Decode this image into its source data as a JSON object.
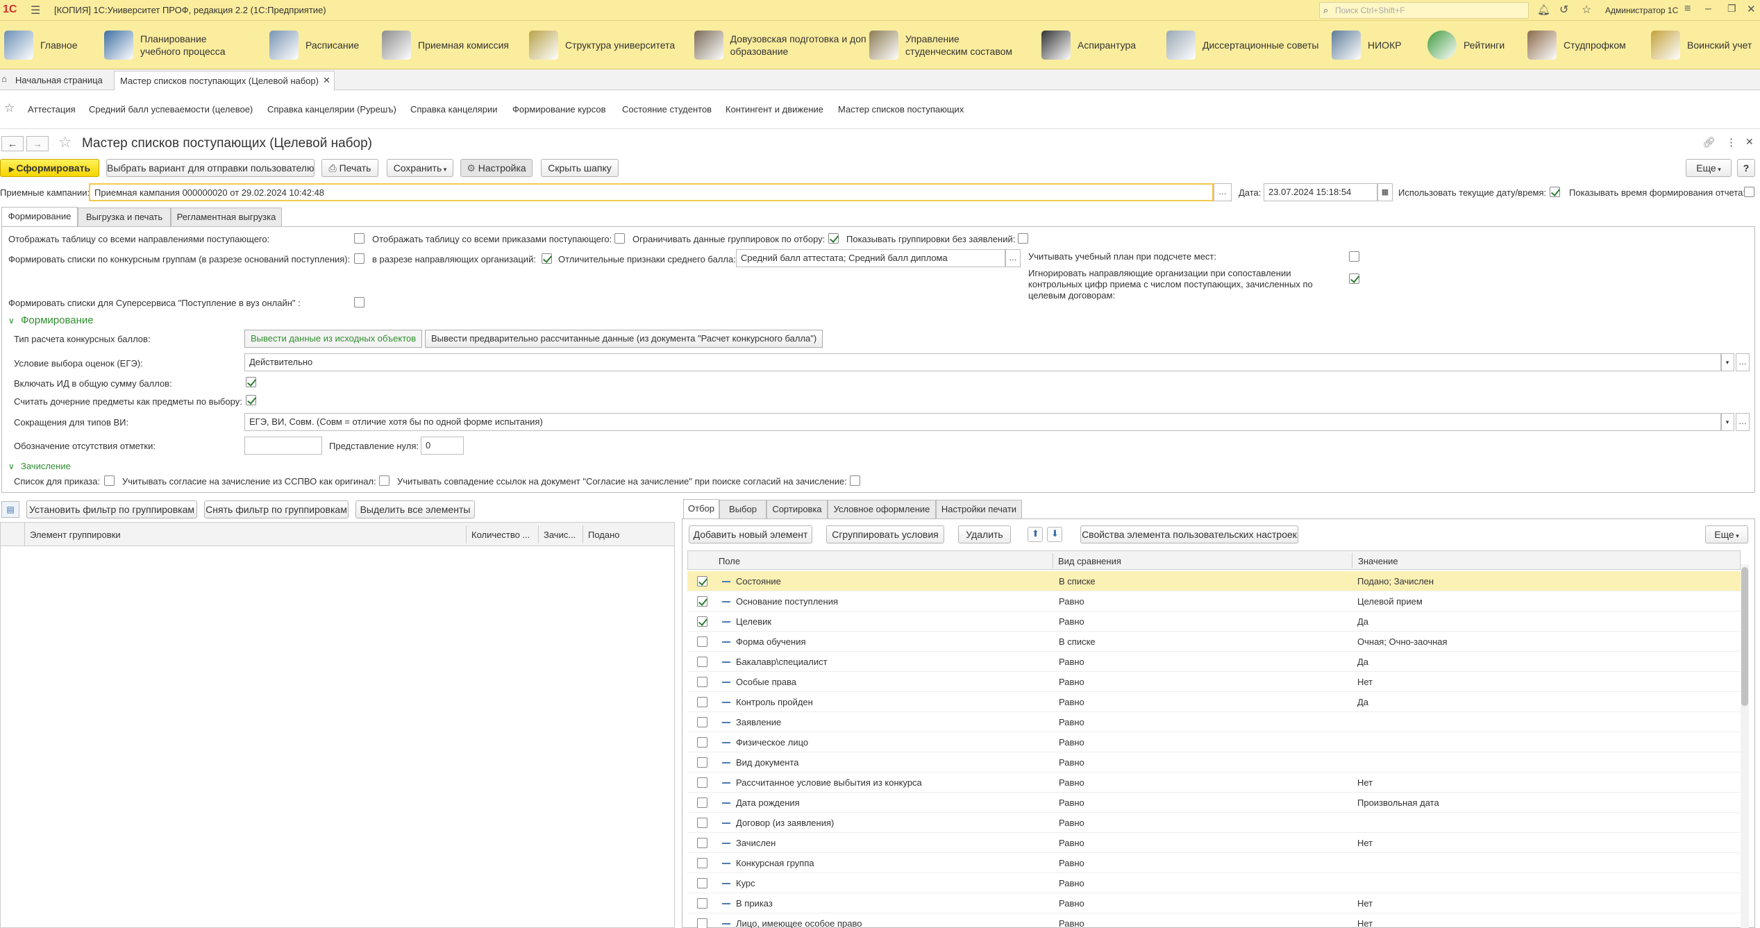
{
  "titlebar": {
    "logo": "1С",
    "title": "[КОПИЯ] 1С:Университет ПРОФ, редакция 2.2  (1С:Предприятие)",
    "search_placeholder": "Поиск Ctrl+Shift+F",
    "user": "Администратор 1С"
  },
  "sections": [
    {
      "label": "Главное",
      "color": "#6b8fb5"
    },
    {
      "label": "Планирование учебного процесса",
      "color": "#3f6fa3"
    },
    {
      "label": "Расписание",
      "color": "#7a95b3"
    },
    {
      "label": "Приемная комиссия",
      "color": "#8d8d8d"
    },
    {
      "label": "Структура университета",
      "color": "#b7a34a"
    },
    {
      "label": "Довузовская подготовка и доп образование",
      "color": "#7a6b58"
    },
    {
      "label": "Управление студенческим составом",
      "color": "#8c7d56"
    },
    {
      "label": "Аспирантура",
      "color": "#333333"
    },
    {
      "label": "Диссертационные советы",
      "color": "#9aa8b6"
    },
    {
      "label": "НИОКР",
      "color": "#5f7c9a"
    },
    {
      "label": "Рейтинги",
      "color": "#3f9a3f"
    },
    {
      "label": "Студпрофком",
      "color": "#8a6a4a"
    },
    {
      "label": "Воинский учет",
      "color": "#c2a23c"
    }
  ],
  "tabs": {
    "home": "Начальная страница",
    "active": "Мастер списков поступающих (Целевой набор)"
  },
  "favorites": [
    "Аттестация",
    "Средний балл успеваемости (целевое)",
    "Справка канцелярии (Рурешъ)",
    "Справка канцелярии",
    "Формирование курсов",
    "Состояние студентов",
    "Контингент и движение",
    "Мастер списков поступающих"
  ],
  "form": {
    "title": "Мастер списков поступающих (Целевой набор)",
    "toolbar": {
      "generate": "Сформировать",
      "choose_variant": "Выбрать вариант для отправки пользователю",
      "print": "Печать",
      "save": "Сохранить",
      "settings": "Настройка",
      "hide_header": "Скрыть шапку",
      "more": "Еще",
      "help": "?"
    },
    "campaigns_label": "Приемные кампании:",
    "campaigns_value": "Приемная кампания 000000020 от 29.02.2024 10:42:48",
    "date_label": "Дата:",
    "date_value": "23.07.2024 15:18:54",
    "use_current_date_label": "Использовать текущие дату/время:",
    "show_time_label": "Показывать время формирования отчета:",
    "subtabs": [
      "Формирование",
      "Выгрузка и печать",
      "Регламентная выгрузка"
    ],
    "opts": {
      "show_all_directions": "Отображать таблицу со всеми направлениями поступающего:",
      "show_all_orders": "Отображать таблицу со всеми приказами поступающего:",
      "limit_groupings": "Ограничивать данные группировок по отбору:",
      "show_groupings_no_apps": "Показывать группировки без заявлений:",
      "by_competitive_groups": "Формировать списки по конкурсным группам (в разрезе оснований поступления):",
      "by_sending_orgs": "в разрезе направляющих организаций:",
      "avg_score_signs": "Отличительные признаки среднего балла:",
      "avg_score_value": "Средний балл аттестата; Средний балл диплома",
      "consider_plan": "Учитывать учебный план при подсчете мест:",
      "ignore_orgs": "Игнорировать направляющие организации при сопоставлении контрольных цифр приема с числом поступающих, зачисленных по целевым договорам:",
      "superservice": "Формировать списки для Суперсервиса \"Поступление в вуз онлайн\" :"
    },
    "group_formation": "Формирование",
    "calc_type_label": "Тип расчета конкурсных баллов:",
    "calc_type_opt1": "Вывести данные из исходных объектов",
    "calc_type_opt2": "Вывести предварительно рассчитанные данные (из документа \"Расчет конкурсного балла\")",
    "exam_condition_label": "Условие выбора оценок (ЕГЭ):",
    "exam_condition_value": "Действительно",
    "include_id_label": "Включать ИД в общую сумму баллов:",
    "child_subjects_label": "Считать дочерние предметы как предметы по выбору:",
    "abbr_label": "Сокращения для типов ВИ:",
    "abbr_value": "ЕГЭ, ВИ, Совм. (Совм = отличие хотя бы по одной форме испытания)",
    "absent_label": "Обозначение отсутствия отметки:",
    "absent_value": "",
    "zero_label": "Представление нуля:",
    "zero_value": "0",
    "group_enroll": "Зачисление",
    "order_list_label": "Список для приказа:",
    "consent_label": "Учитывать согласие на зачисление из ССПВО как оригинал:",
    "consent_match_label": "Учитывать совпадение ссылок на документ \"Согласие на зачисление\" при поиске согласий на зачисление:"
  },
  "left_panel": {
    "buttons": [
      "Установить фильтр по группировкам",
      "Снять фильтр по группировкам",
      "Выделить все элементы"
    ],
    "columns": [
      "Элемент группировки",
      "Количество ...",
      "Зачис...",
      "Подано"
    ]
  },
  "right_panel": {
    "tabs": [
      "Отбор",
      "Выбор",
      "Сортировка",
      "Условное оформление",
      "Настройки печати"
    ],
    "buttons": {
      "add": "Добавить новый элемент",
      "group": "Сгруппировать условия",
      "delete": "Удалить",
      "props": "Свойства элемента пользовательских настроек",
      "more": "Еще"
    },
    "columns": [
      "Поле",
      "Вид сравнения",
      "Значение"
    ],
    "rows": [
      {
        "on": true,
        "field": "Состояние",
        "cmp": "В списке",
        "val": "Подано; Зачислен"
      },
      {
        "on": true,
        "field": "Основание поступления",
        "cmp": "Равно",
        "val": "Целевой прием"
      },
      {
        "on": true,
        "field": "Целевик",
        "cmp": "Равно",
        "val": "Да"
      },
      {
        "on": false,
        "field": "Форма обучения",
        "cmp": "В списке",
        "val": "Очная; Очно-заочная"
      },
      {
        "on": false,
        "field": "Бакалавр\\специалист",
        "cmp": "Равно",
        "val": "Да"
      },
      {
        "on": false,
        "field": "Особые права",
        "cmp": "Равно",
        "val": "Нет"
      },
      {
        "on": false,
        "field": "Контроль пройден",
        "cmp": "Равно",
        "val": "Да"
      },
      {
        "on": false,
        "field": "Заявление",
        "cmp": "Равно",
        "val": ""
      },
      {
        "on": false,
        "field": "Физическое лицо",
        "cmp": "Равно",
        "val": ""
      },
      {
        "on": false,
        "field": "Вид документа",
        "cmp": "Равно",
        "val": ""
      },
      {
        "on": false,
        "field": "Рассчитанное условие выбытия из конкурса",
        "cmp": "Равно",
        "val": "Нет"
      },
      {
        "on": false,
        "field": "Дата рождения",
        "cmp": "Равно",
        "val": "Произвольная дата"
      },
      {
        "on": false,
        "field": "Договор (из заявления)",
        "cmp": "Равно",
        "val": ""
      },
      {
        "on": false,
        "field": "Зачислен",
        "cmp": "Равно",
        "val": "Нет"
      },
      {
        "on": false,
        "field": "Конкурсная группа",
        "cmp": "Равно",
        "val": ""
      },
      {
        "on": false,
        "field": "Курс",
        "cmp": "Равно",
        "val": ""
      },
      {
        "on": false,
        "field": "В приказ",
        "cmp": "Равно",
        "val": "Нет"
      },
      {
        "on": false,
        "field": "Лицо, имеющее особое право",
        "cmp": "Равно",
        "val": "Нет"
      }
    ]
  }
}
